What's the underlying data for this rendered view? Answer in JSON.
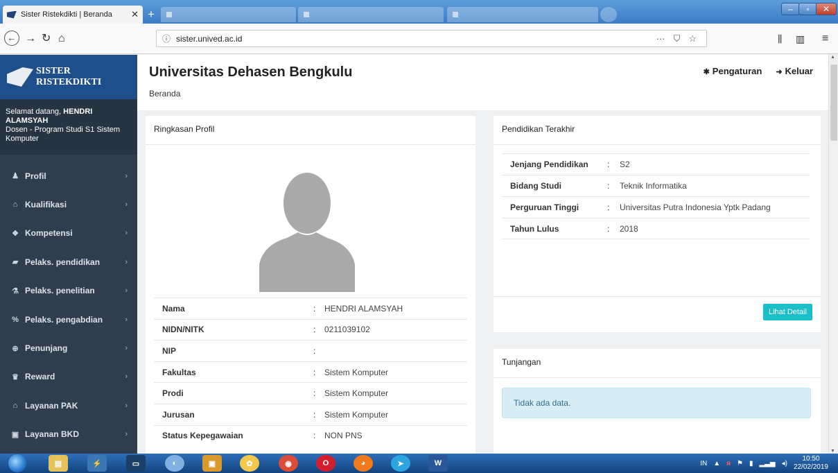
{
  "browser": {
    "active_tab_title": "Sister Ristekdikti | Beranda",
    "url_host": "sister.unived.ac.id",
    "page_actions_icon": "ellipsis-icon",
    "pocket_icon": "pocket-icon",
    "bookmark_icon": "star-icon"
  },
  "sidebar": {
    "brand_line1": "SISTER",
    "brand_line2": "RISTEKDIKTI",
    "welcome_prefix": "Selamat datang, ",
    "user_name": "HENDRI ALAMSYAH",
    "user_role": "Dosen - Program Studi S1 Sistem Komputer",
    "items": [
      {
        "label": "Profil",
        "icon": "user-icon"
      },
      {
        "label": "Kualifikasi",
        "icon": "graduation-cap-icon"
      },
      {
        "label": "Kompetensi",
        "icon": "cubes-icon"
      },
      {
        "label": "Pelaks. pendidikan",
        "icon": "book-icon"
      },
      {
        "label": "Pelaks. penelitian",
        "icon": "flask-icon"
      },
      {
        "label": "Pelaks. pengabdian",
        "icon": "percent-icon"
      },
      {
        "label": "Penunjang",
        "icon": "support-icon"
      },
      {
        "label": "Reward",
        "icon": "trophy-icon"
      },
      {
        "label": "Layanan PAK",
        "icon": "graduation-cap-icon"
      },
      {
        "label": "Layanan BKD",
        "icon": "briefcase-icon"
      }
    ]
  },
  "header": {
    "title": "Universitas Dehasen Bengkulu",
    "breadcrumb": "Beranda",
    "settings_label": "Pengaturan",
    "logout_label": "Keluar"
  },
  "profile": {
    "heading": "Ringkasan Profil",
    "rows": [
      {
        "label": "Nama",
        "value": "HENDRI ALAMSYAH"
      },
      {
        "label": "NIDN/NITK",
        "value": "0211039102"
      },
      {
        "label": "NIP",
        "value": ""
      },
      {
        "label": "Fakultas",
        "value": "Sistem Komputer"
      },
      {
        "label": "Prodi",
        "value": "Sistem Komputer"
      },
      {
        "label": "Jurusan",
        "value": "Sistem Komputer"
      },
      {
        "label": "Status Kepegawaian",
        "value": "NON PNS"
      }
    ]
  },
  "education": {
    "heading": "Pendidikan Terakhir",
    "rows": [
      {
        "label": "Jenjang Pendidikan",
        "value": "S2"
      },
      {
        "label": "Bidang Studi",
        "value": "Teknik Informatika"
      },
      {
        "label": "Perguruan Tinggi",
        "value": "Universitas Putra Indonesia Yptk Padang"
      },
      {
        "label": "Tahun Lulus",
        "value": "2018"
      }
    ],
    "detail_button": "Lihat Detail"
  },
  "allowance": {
    "heading": "Tunjangan",
    "empty_text": "Tidak ada data."
  },
  "taskbar": {
    "tray_lang": "IN",
    "time": "10:50",
    "date": "22/02/2019"
  },
  "colors": {
    "sidebar_bg": "#2f3d4c",
    "brand_bg": "#1f4f8b",
    "accent_button": "#1bbfc9",
    "info_alert_bg": "#d9edf7"
  }
}
